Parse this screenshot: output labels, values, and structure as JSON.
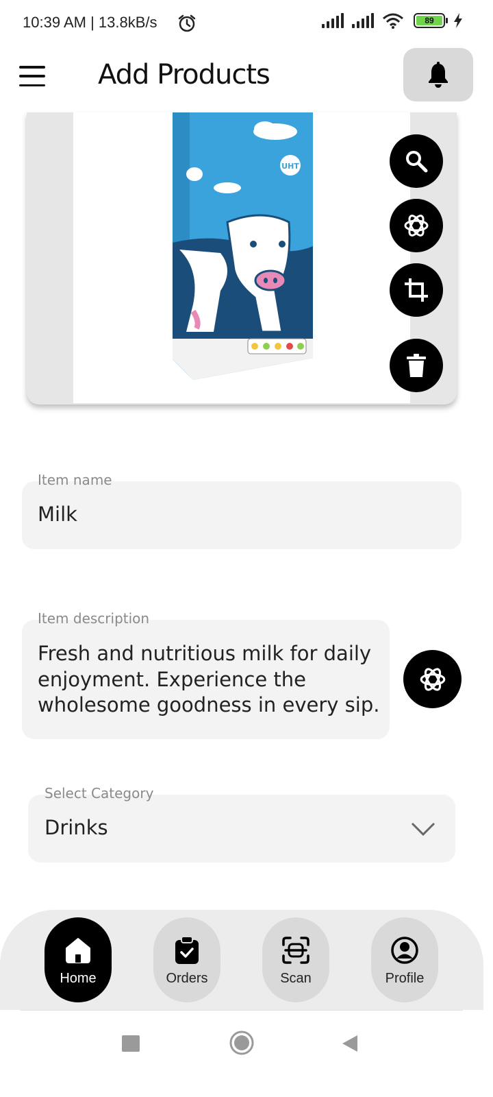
{
  "status_bar": {
    "time": "10:39 AM | 13.8kB/s",
    "battery": "89"
  },
  "header": {
    "title": "Add Products"
  },
  "product_image": {
    "carton_badge": "UHT"
  },
  "form": {
    "name_label": "Item name",
    "name_value": "Milk",
    "description_label": "Item description",
    "description_value": "Fresh and nutritious milk for daily enjoyment. Experience the wholesome goodness in every sip.",
    "category_label": "Select Category",
    "category_value": "Drinks"
  },
  "bottom_nav": {
    "items": [
      {
        "label": "Home",
        "icon": "home-icon",
        "active": true
      },
      {
        "label": "Orders",
        "icon": "clipboard-check-icon",
        "active": false
      },
      {
        "label": "Scan",
        "icon": "scan-icon",
        "active": false
      },
      {
        "label": "Profile",
        "icon": "profile-icon",
        "active": false
      }
    ]
  },
  "colors": {
    "accent": "#000000",
    "field_bg": "#f3f3f3",
    "nav_bg": "#ececec",
    "inactive_pill": "#d9d9d9",
    "carton_blue": "#3aa3dc"
  }
}
